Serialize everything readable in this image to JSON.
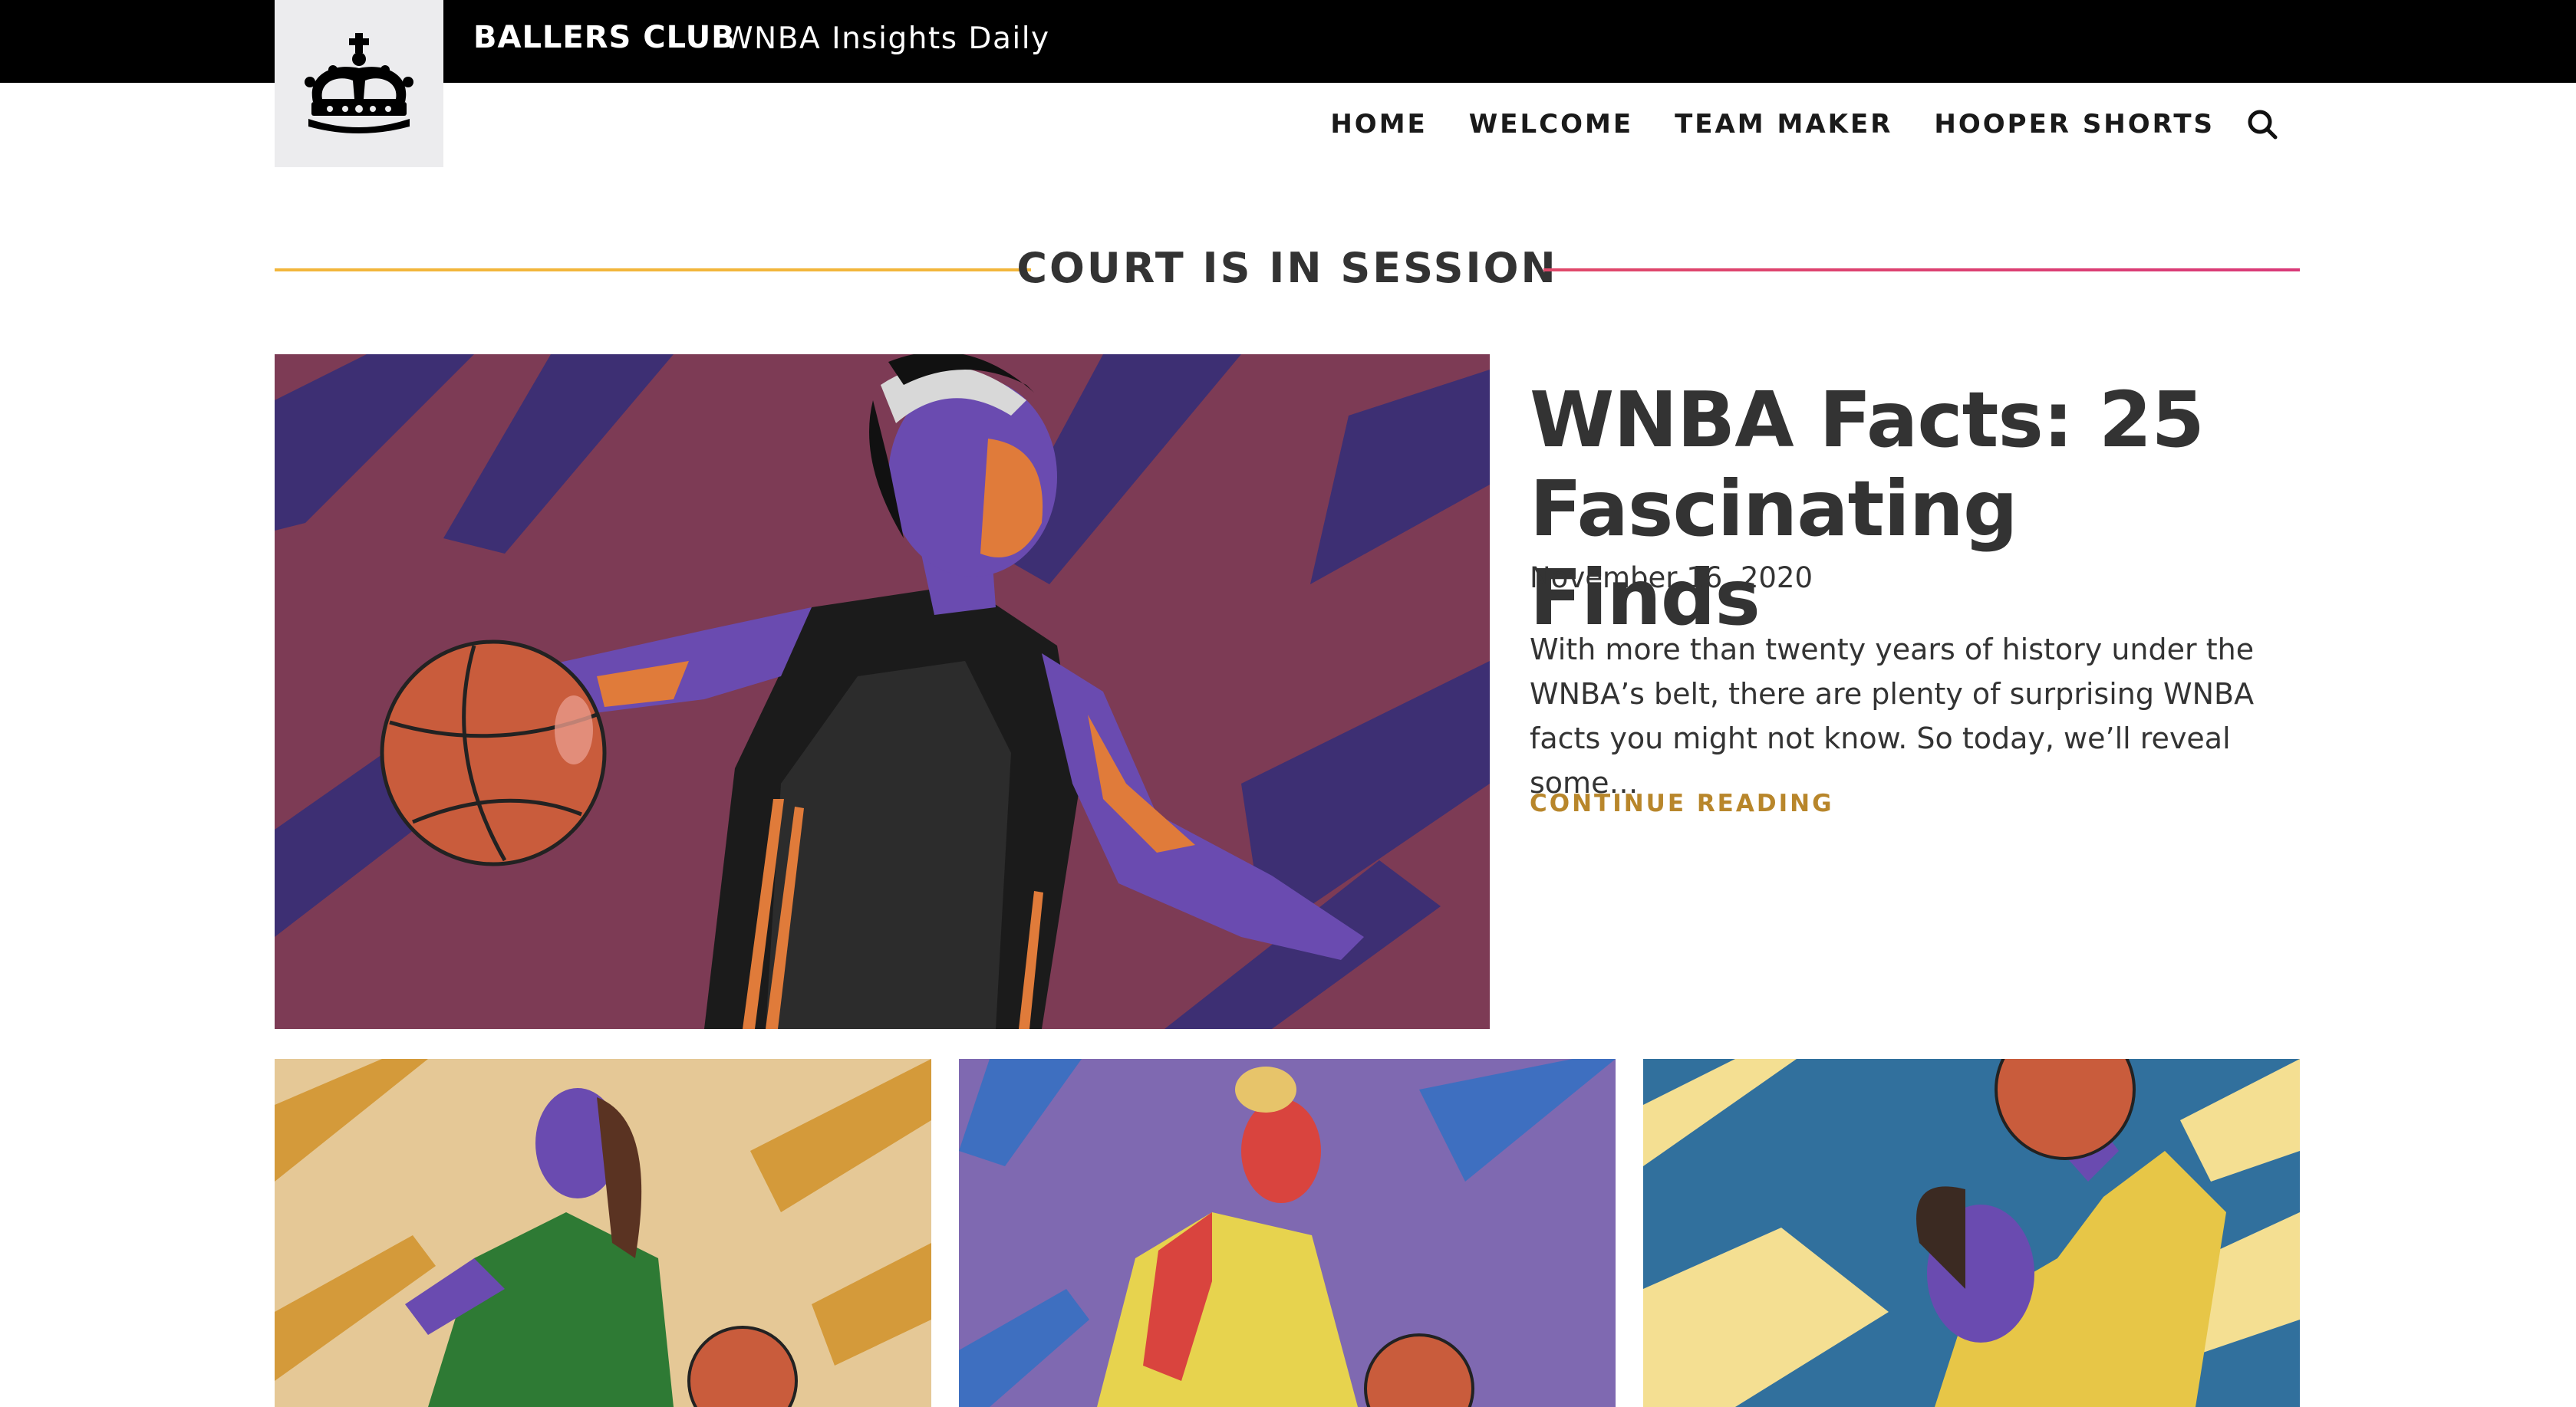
{
  "header": {
    "site_title": "BALLERS CLUB",
    "tagline": "WNBA Insights Daily",
    "logo_icon": "crown-icon"
  },
  "nav": {
    "items": [
      {
        "label": "HOME"
      },
      {
        "label": "WELCOME"
      },
      {
        "label": "TEAM MAKER"
      },
      {
        "label": "HOOPER SHORTS"
      }
    ],
    "search_icon": "search-icon"
  },
  "section": {
    "heading": "COURT IS IN SESSION"
  },
  "featured_post": {
    "title": "WNBA Facts: 25 Fascinating Finds",
    "date": "November 16, 2020",
    "excerpt": "With more than twenty years of history under the WNBA’s belt, there are plenty of surprising WNBA facts you might not know. So today, we’ll reveal some…",
    "continue_label": "CONTINUE READING"
  },
  "colors": {
    "topbar": "#000000",
    "accent_gold": "#b8862b",
    "line_left": "#f2b63c",
    "line_right": "#e0486a",
    "featured_bg": "#7d3b55",
    "card1_bg": "#e5c896",
    "card2_bg": "#7f69b1",
    "card3_bg": "#31709d"
  }
}
